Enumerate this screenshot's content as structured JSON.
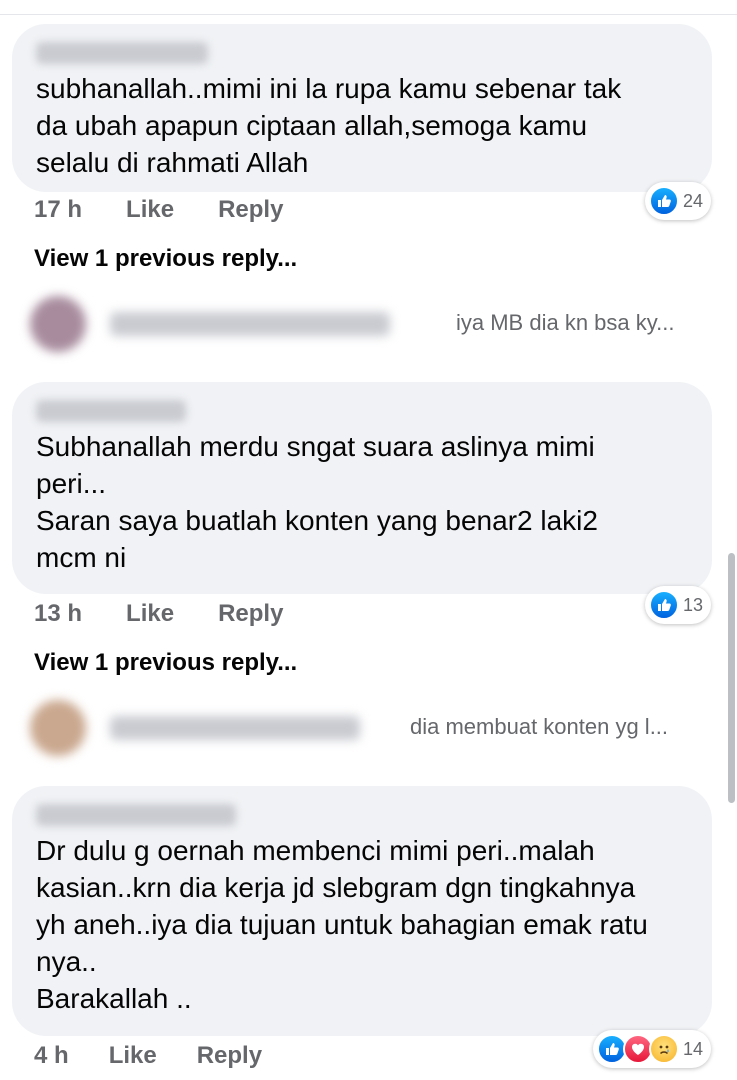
{
  "comments": [
    {
      "text": "subhanallah..mimi ini la rupa kamu sebenar tak\nda ubah apapun ciptaan allah,semoga kamu\nselalu di rahmati Allah",
      "time": "17 h",
      "like_label": "Like",
      "reply_label": "Reply",
      "reactions": [
        "like"
      ],
      "reaction_count": "24",
      "view_previous": "View 1 previous reply...",
      "reply_preview": "iya MB dia kn bsa ky..."
    },
    {
      "text": "Subhanallah merdu sngat suara aslinya mimi\nperi...\nSaran saya buatlah konten yang benar2 laki2\nmcm ni",
      "time": "13 h",
      "like_label": "Like",
      "reply_label": "Reply",
      "reactions": [
        "like"
      ],
      "reaction_count": "13",
      "view_previous": "View 1 previous reply...",
      "reply_preview": "dia membuat konten yg l..."
    },
    {
      "text": "Dr dulu g oernah membenci mimi peri..malah\nkasian..krn dia kerja jd slebgram dgn tingkahnya\nyh aneh..iya dia tujuan untuk bahagian emak ratu\nnya..\nBarakallah ..",
      "time": "4 h",
      "like_label": "Like",
      "reply_label": "Reply",
      "reactions": [
        "like",
        "love",
        "sad"
      ],
      "reaction_count": "14"
    }
  ],
  "colors": {
    "bubble": "#f0f2f5",
    "secondary_text": "#65676b",
    "like_blue": "#1877f2",
    "love_red": "#f33e58",
    "sad_yellow": "#f7b125"
  }
}
